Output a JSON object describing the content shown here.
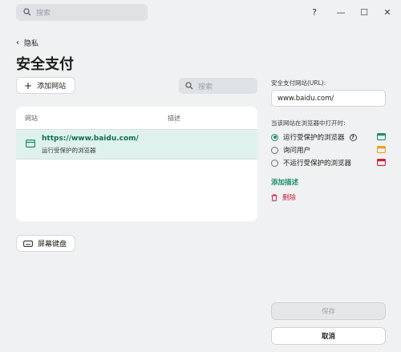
{
  "titlebar": {
    "search_placeholder": "搜索",
    "help": "?",
    "minimize": "—",
    "maximize": "☐",
    "close": "✕"
  },
  "nav": {
    "back_label": "隐私"
  },
  "page": {
    "title": "安全支付"
  },
  "toolbar": {
    "add_label": "添加网站",
    "search_placeholder": "搜索"
  },
  "table": {
    "columns": [
      "网站",
      "描述"
    ],
    "rows": [
      {
        "url": "https://www.baidu.com/",
        "mode": "运行受保护的浏览器",
        "description": ""
      }
    ]
  },
  "keyboard_button": "屏幕键盘",
  "detail": {
    "url_label": "安全支付网站(URL):",
    "url_value": "www.baidu.com/",
    "open_label": "当该网站在浏览器中打开时:",
    "options": [
      {
        "label": "运行受保护的浏览器",
        "selected": true,
        "color": "#1f8f6d"
      },
      {
        "label": "询问用户",
        "selected": false,
        "color": "#e8a317"
      },
      {
        "label": "不运行受保护的浏览器",
        "selected": false,
        "color": "#c9243f"
      }
    ],
    "add_description": "添加描述",
    "delete": "删除"
  },
  "footer": {
    "save": "保存",
    "cancel": "取消"
  },
  "colors": {
    "accent": "#1f8f6d",
    "danger": "#c9243f",
    "row_selected": "#dff1ec"
  }
}
